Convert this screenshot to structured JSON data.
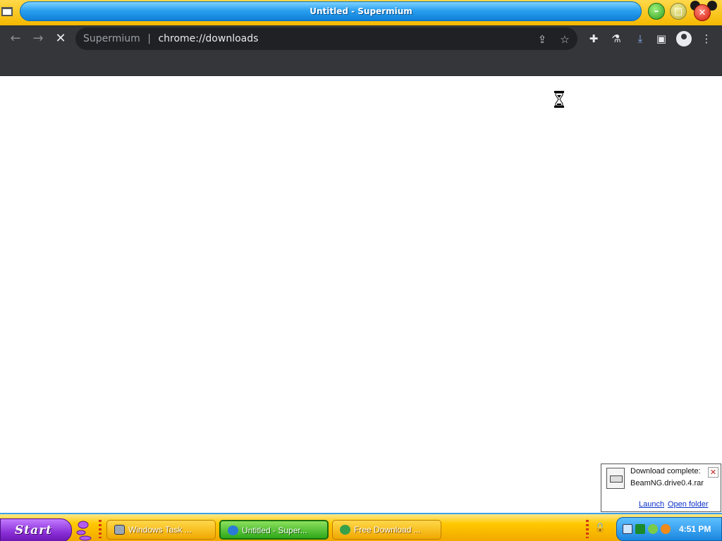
{
  "window": {
    "title": "Untitled - Supermium",
    "min_icon": "minimize-icon",
    "max_icon": "maximize-icon",
    "close_icon": "close-icon"
  },
  "toolbar": {
    "back_icon": "arrow-left-icon",
    "forward_icon": "arrow-right-icon",
    "stop_icon": "stop-icon",
    "omnibox": {
      "prefix": "Supermium",
      "separator": "|",
      "url": "chrome://downloads"
    },
    "share_icon": "share-icon",
    "bookmark_icon": "star-icon",
    "extensions_icon": "puzzle-icon",
    "labs_icon": "flask-icon",
    "downloads_icon": "download-icon",
    "sidepanel_icon": "side-panel-icon",
    "profile_icon": "profile-icon",
    "menu_icon": "kebab-menu-icon",
    "glyphs": {
      "back": "←",
      "forward": "→",
      "stop": "✕",
      "share": "⇪",
      "star": "☆",
      "puzzle": "✚",
      "flask": "⚗",
      "download": "⤓",
      "panel": "▣",
      "menu": "⋮"
    }
  },
  "download_notification": {
    "line1": "Download complete:",
    "line2": "BeamNG.drive0.4.rar",
    "launch": "Launch",
    "open_folder": "Open folder",
    "close": "✕"
  },
  "taskbar": {
    "start_label": "Start",
    "tasks": [
      {
        "label": "Windows Task ...",
        "active": false
      },
      {
        "label": "Untitled - Super...",
        "active": true
      },
      {
        "label": "Free Download ...",
        "active": false
      }
    ],
    "clock": "4:51 PM",
    "lock_glyph": "🔒"
  },
  "colors": {
    "chrome_dark": "#35363a",
    "omnibox": "#202124",
    "titlebar_blue": "#2aa0f0",
    "taskbar_yellow": "#ffc800",
    "start_purple": "#8a2fd6",
    "active_task_green": "#2fa81a"
  }
}
